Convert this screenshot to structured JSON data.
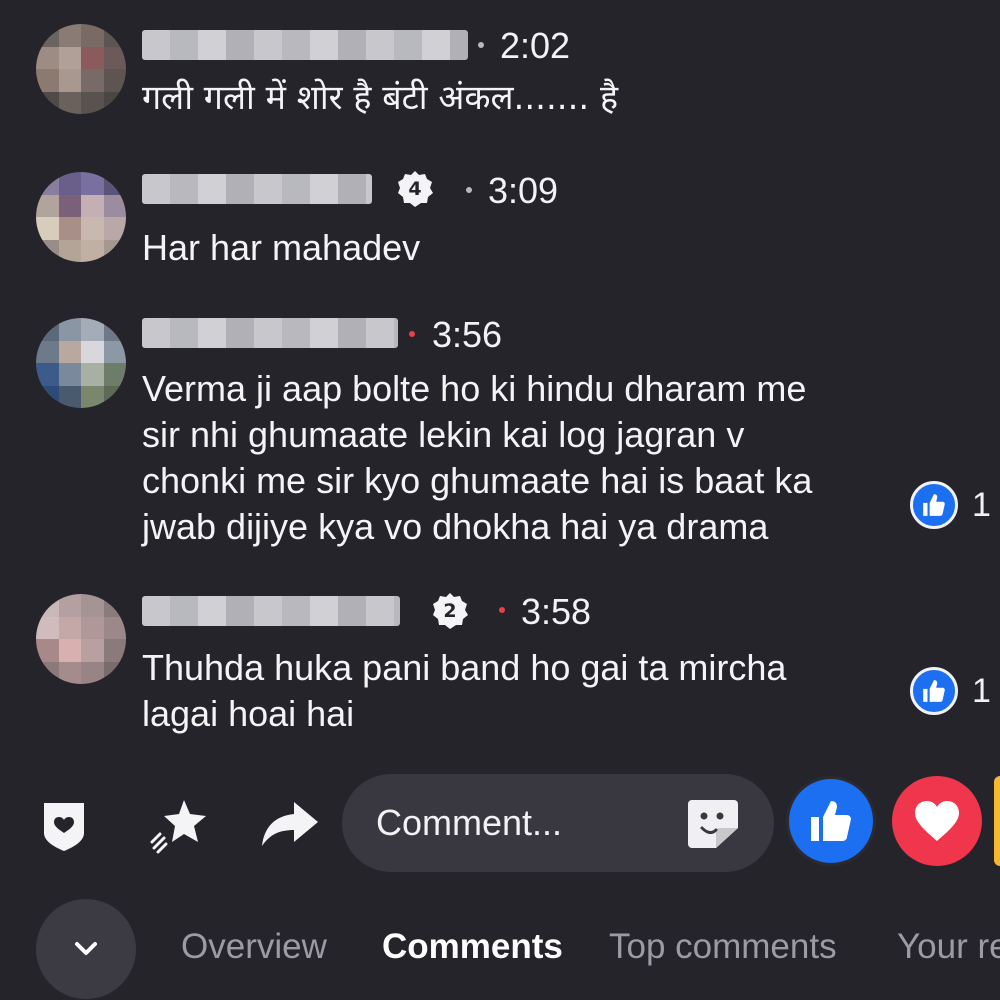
{
  "comments": [
    {
      "time": "2:02",
      "text": "गली गली में शोर है बंटी अंकल....... है",
      "badge": null,
      "likes": null
    },
    {
      "time": "3:09",
      "text": "Har har mahadev",
      "badge": "4",
      "likes": null
    },
    {
      "time": "3:56",
      "text_lines": [
        "Verma ji aap bolte ho ki hindu dharam me",
        "sir nhi ghumaate lekin kai log jagran v",
        "chonki me sir kyo ghumaate hai is baat ka",
        "jwab dijiye kya vo dhokha hai ya drama"
      ],
      "badge": null,
      "likes": "1"
    },
    {
      "time": "3:58",
      "text_lines": [
        "Thuhda huka pani band ho gai ta mircha",
        "lagai hoai hai"
      ],
      "badge": "2",
      "likes": "1"
    }
  ],
  "composer": {
    "placeholder": "Comment..."
  },
  "tabs": [
    "Overview",
    "Comments",
    "Top comments",
    "Your re"
  ],
  "active_tab": "Comments",
  "colors": {
    "background": "#25242b",
    "like_blue": "#1b6ff0",
    "love_red": "#f0364d",
    "live_dot": "#e8404e"
  },
  "icons": [
    "shield-heart-icon",
    "sparkle-star-icon",
    "share-arrow-icon",
    "sticker-icon",
    "like-reaction-icon",
    "love-reaction-icon",
    "chevron-down-icon"
  ]
}
